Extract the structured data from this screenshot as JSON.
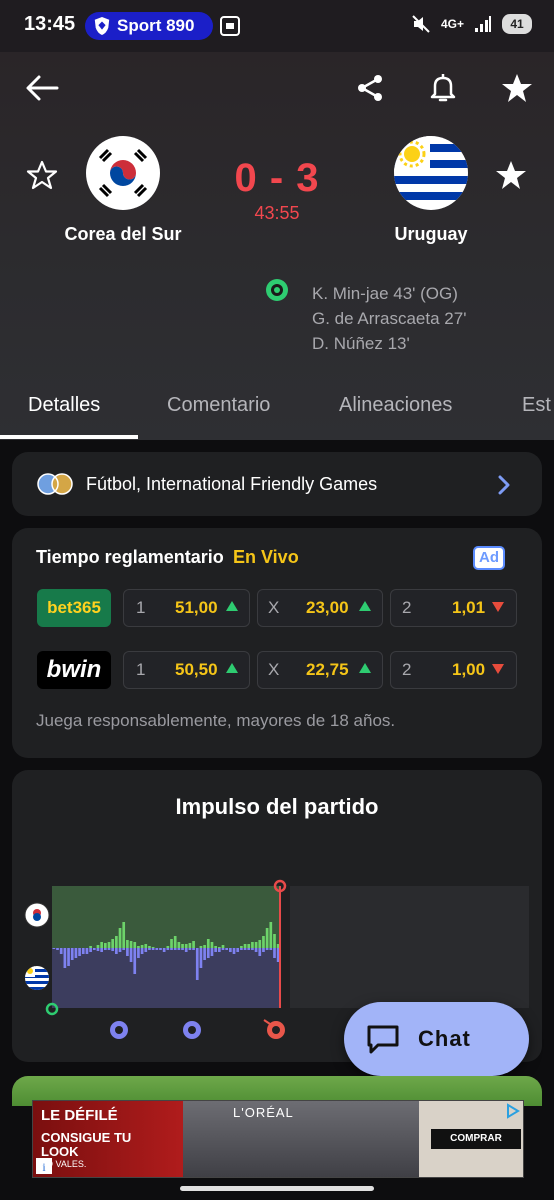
{
  "status_bar": {
    "time": "13:45",
    "app_pill": "Sport 890",
    "network": "4G+",
    "battery": "41"
  },
  "match": {
    "home_team": "Corea del Sur",
    "away_team": "Uruguay",
    "score": "0 - 3",
    "clock": "43:55",
    "goals": [
      "K. Min-jae 43' (OG)",
      "G. de Arrascaeta 27'",
      "D. Núñez 13'"
    ]
  },
  "tabs": [
    "Detalles",
    "Comentario",
    "Alineaciones",
    "Est"
  ],
  "league": {
    "label": "Fútbol, International Friendly Games"
  },
  "odds": {
    "title": "Tiempo reglamentario",
    "live": "En Vivo",
    "ad": "Ad",
    "rows": [
      {
        "bookmaker": "bet365",
        "home_label": "1",
        "home": "51,00",
        "home_trend": "up",
        "draw_label": "X",
        "draw": "23,00",
        "draw_trend": "up",
        "away_label": "2",
        "away": "1,01",
        "away_trend": "down"
      },
      {
        "bookmaker": "bwin",
        "home_label": "1",
        "home": "50,50",
        "home_trend": "up",
        "draw_label": "X",
        "draw": "22,75",
        "draw_trend": "up",
        "away_label": "2",
        "away": "1,00",
        "away_trend": "down"
      }
    ],
    "disclaimer": "Juega responsablemente, mayores de 18 años."
  },
  "momentum": {
    "title": "Impulso del partido",
    "home_bars": [
      0,
      0,
      0,
      0,
      0,
      0,
      0,
      0,
      0,
      0,
      2,
      0,
      3,
      6,
      5,
      6,
      9,
      12,
      20,
      26,
      8,
      7,
      6,
      2,
      3,
      4,
      2,
      1,
      0,
      0,
      0,
      2,
      9,
      12,
      6,
      4,
      4,
      5,
      7,
      0,
      2,
      3,
      9,
      6,
      2,
      1,
      3,
      0,
      0,
      0,
      0,
      2,
      4,
      4,
      6,
      6,
      8,
      12,
      20,
      26,
      14,
      4
    ],
    "away_bars": [
      1,
      2,
      6,
      20,
      18,
      12,
      10,
      8,
      6,
      6,
      4,
      2,
      3,
      4,
      2,
      2,
      3,
      6,
      4,
      2,
      8,
      14,
      26,
      10,
      6,
      4,
      2,
      2,
      2,
      2,
      4,
      2,
      2,
      2,
      2,
      2,
      4,
      2,
      2,
      32,
      20,
      12,
      10,
      8,
      4,
      4,
      2,
      2,
      4,
      6,
      4,
      2,
      2,
      2,
      2,
      4,
      8,
      4,
      2,
      2,
      10,
      14
    ],
    "events": [
      "goal",
      "goal",
      "own-goal"
    ]
  },
  "chat": {
    "label": "Chat"
  },
  "ad_banner": {
    "headline": "LE DÉFILÉ",
    "sub": "CONSIGUE TU LOOK",
    "small": "LO VALES.",
    "brand": "L'ORÉAL",
    "cta": "COMPRAR"
  },
  "colors": {
    "score_red": "#f2474e",
    "odds_yellow": "#f5c518",
    "up_green": "#2ecc71",
    "down_red": "#e74c3c",
    "home_bar": "#6dd36a",
    "away_bar": "#7e82f0",
    "chat_bg": "#a2b4f8"
  }
}
